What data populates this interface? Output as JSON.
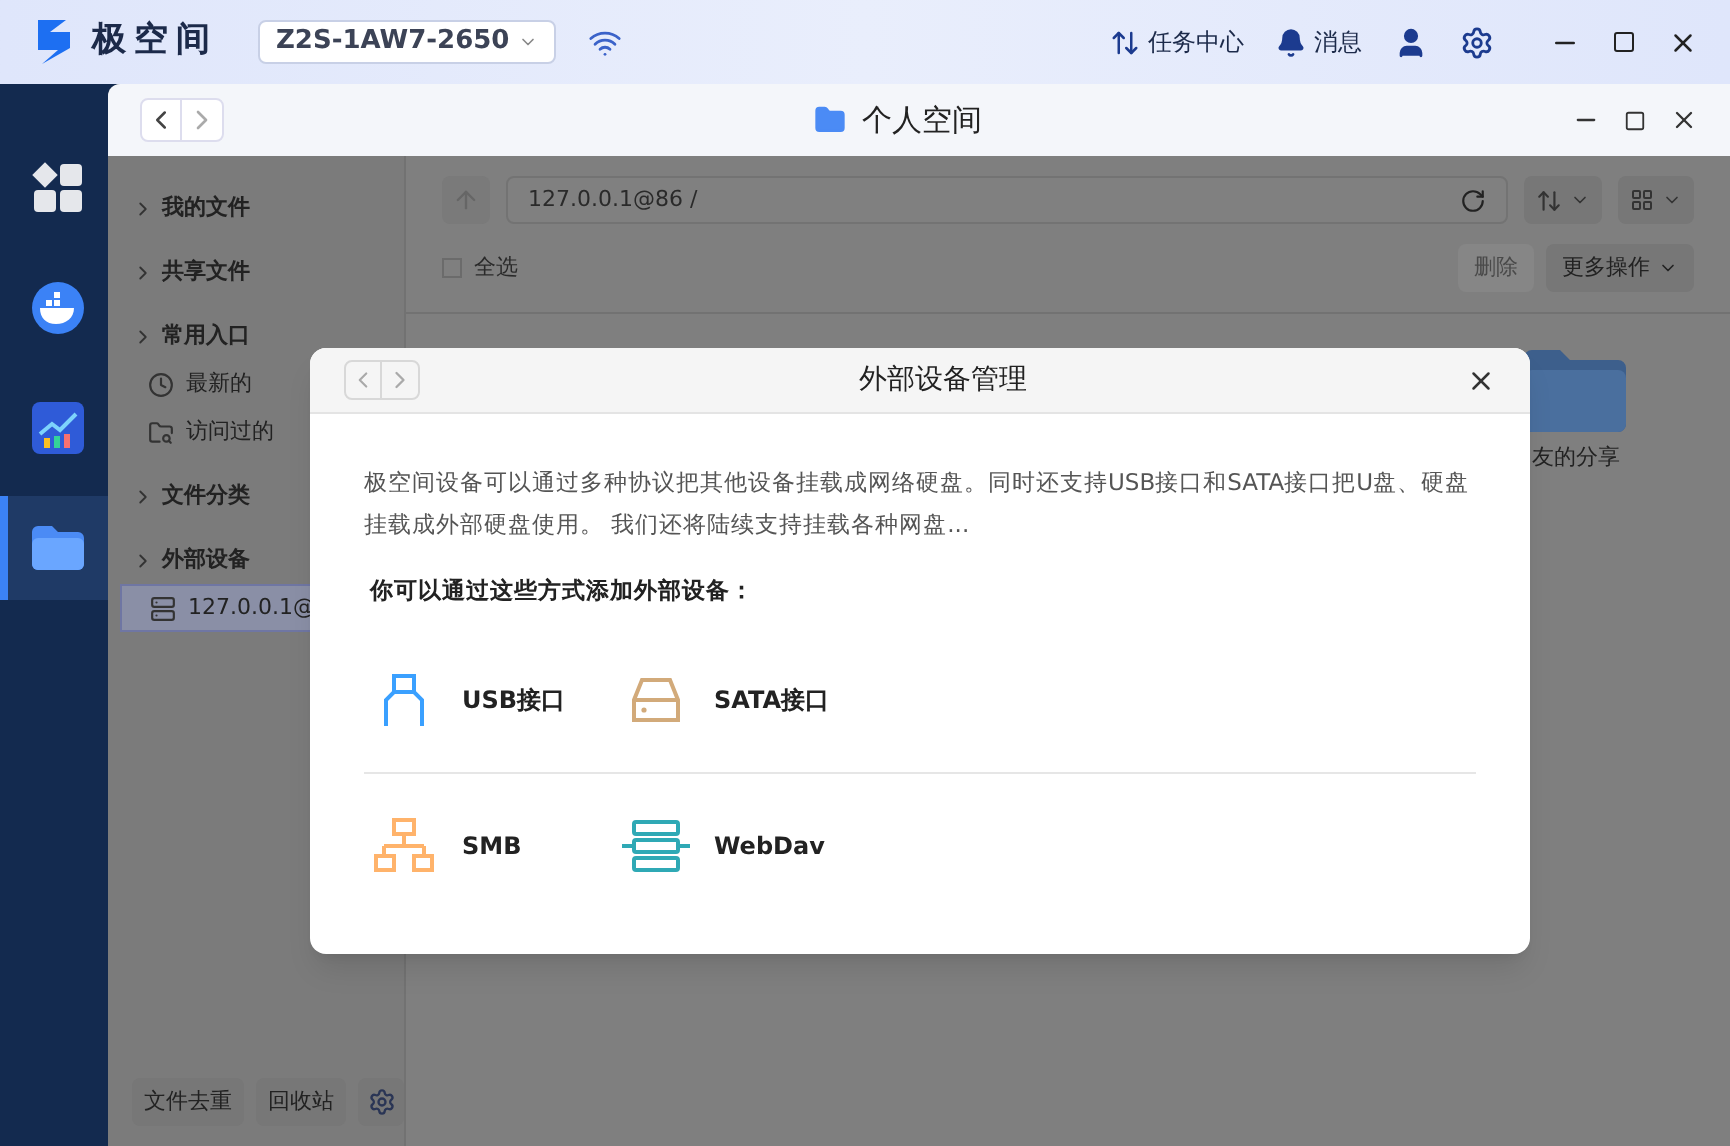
{
  "topbar": {
    "brand": "极空间",
    "device": "Z2S-1AW7-2650",
    "actions": [
      {
        "kind": "tasks",
        "label": "任务中心"
      },
      {
        "kind": "bell",
        "label": "消息"
      }
    ]
  },
  "dock": [
    {
      "kind": "grid",
      "selected": false
    },
    {
      "kind": "whale",
      "selected": false
    },
    {
      "kind": "chart",
      "selected": false
    },
    {
      "kind": "folder",
      "selected": true
    }
  ],
  "window": {
    "title": "个人空间"
  },
  "sidebar": {
    "sections": [
      {
        "label": "我的文件"
      },
      {
        "label": "共享文件"
      },
      {
        "label": "常用入口",
        "children": [
          {
            "kind": "clock",
            "label": "最新的",
            "selected": false
          },
          {
            "kind": "visited",
            "label": "访问过的",
            "selected": false
          }
        ]
      },
      {
        "label": "文件分类"
      },
      {
        "label": "外部设备",
        "children": [
          {
            "kind": "server",
            "label": "127.0.0.1@",
            "selected": true
          }
        ]
      }
    ],
    "buttons": [
      "文件去重",
      "回收站"
    ]
  },
  "main": {
    "path": "127.0.0.1@86 /",
    "select_all": {
      "label": "全选",
      "checked": false
    },
    "toolbar": [
      {
        "label": "删除",
        "disabled": true
      },
      {
        "label": "更多操作",
        "disabled": false
      }
    ],
    "file": "友的分享"
  },
  "dialog": {
    "title": "外部设备管理",
    "description": "极空间设备可以通过多种协议把其他设备挂载成网络硬盘。同时还支持USB接口和SATA接口把U盘、硬盘挂载成外部硬盘使用。 我们还将陆续支持挂载各种网盘...",
    "subtitle": "你可以通过这些方式添加外部设备：",
    "rows": [
      [
        {
          "kind": "usb",
          "label": "USB接口"
        },
        {
          "kind": "sata",
          "label": "SATA接口"
        }
      ],
      [
        {
          "kind": "smb",
          "label": "SMB"
        },
        {
          "kind": "webdav",
          "label": "WebDav"
        }
      ]
    ]
  }
}
